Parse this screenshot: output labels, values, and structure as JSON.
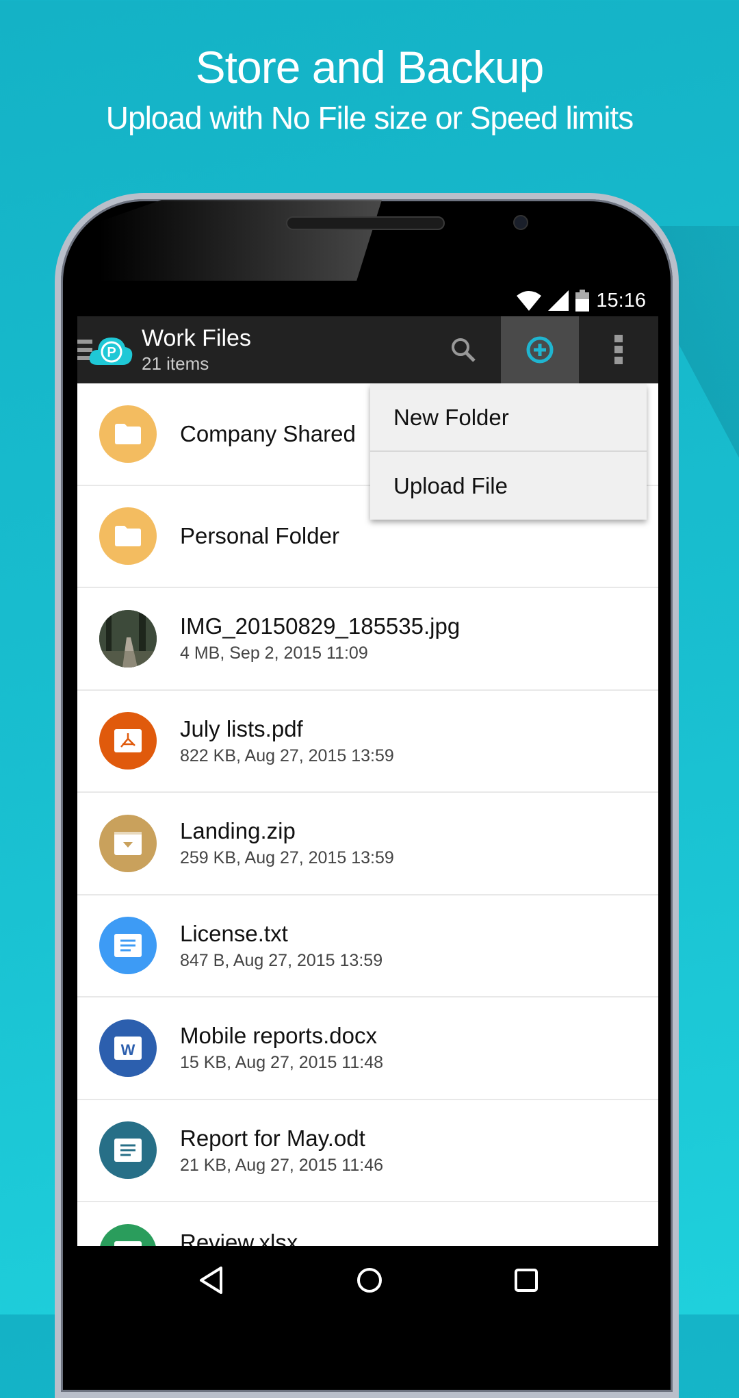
{
  "promo": {
    "title": "Store and Backup",
    "subtitle": "Upload with No File size or Speed limits"
  },
  "status_bar": {
    "time": "15:16",
    "icons": [
      "wifi-icon",
      "signal-icon",
      "battery-icon"
    ]
  },
  "toolbar": {
    "title": "Work Files",
    "subtitle": "21 items",
    "icons": [
      "menu-icon",
      "pcloud-logo",
      "search-icon",
      "add-circle-icon",
      "more-vert-icon"
    ],
    "accent": "#1fb5d0"
  },
  "menu": {
    "items": [
      {
        "label": "New Folder"
      },
      {
        "label": "Upload File"
      }
    ]
  },
  "files": [
    {
      "name": "Company Shared",
      "meta": "",
      "type": "folder",
      "color": "#f3bc60"
    },
    {
      "name": "Personal Folder",
      "meta": "",
      "type": "folder",
      "color": "#f3bc60"
    },
    {
      "name": "IMG_20150829_185535.jpg",
      "meta": "4 MB, Sep 2, 2015 11:09",
      "type": "image",
      "color": "#4a5a48"
    },
    {
      "name": "July lists.pdf",
      "meta": "822 KB, Aug 27, 2015 13:59",
      "type": "pdf",
      "color": "#e05a0c"
    },
    {
      "name": "Landing.zip",
      "meta": "259 KB, Aug 27, 2015 13:59",
      "type": "zip",
      "color": "#c9a15c"
    },
    {
      "name": "License.txt",
      "meta": "847 B, Aug 27, 2015 13:59",
      "type": "text",
      "color": "#3d9bf5"
    },
    {
      "name": "Mobile reports.docx",
      "meta": "15 KB, Aug 27, 2015 11:48",
      "type": "word",
      "color": "#2c5fae"
    },
    {
      "name": "Report for May.odt",
      "meta": "21 KB, Aug 27, 2015 11:46",
      "type": "text",
      "color": "#276f87"
    },
    {
      "name": "Review.xlsx",
      "meta": "",
      "type": "sheet",
      "color": "#2a9d5c"
    }
  ],
  "nav": {
    "icons": [
      "back-icon",
      "home-icon",
      "recents-icon"
    ]
  }
}
